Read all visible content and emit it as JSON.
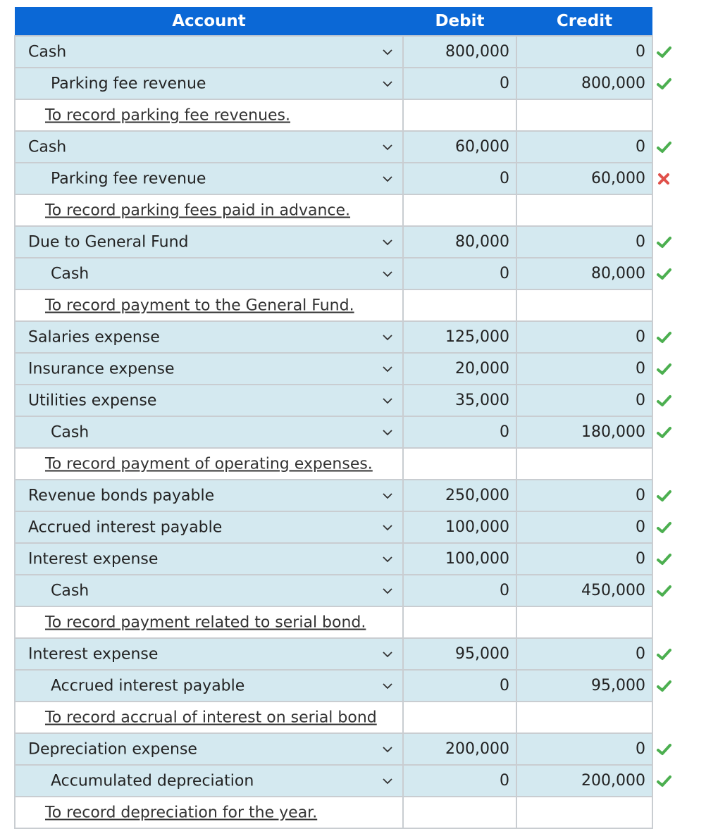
{
  "header": {
    "account": "Account",
    "debit": "Debit",
    "credit": "Credit"
  },
  "colors": {
    "header_bg": "#0b68d6",
    "row_bg": "#d4e9f0",
    "correct": "#4caf50",
    "incorrect": "#e0504a"
  },
  "rows": [
    {
      "type": "entry",
      "indent": false,
      "account": "Cash",
      "debit": "800,000",
      "credit": "0",
      "status": "correct"
    },
    {
      "type": "entry",
      "indent": true,
      "account": "Parking fee revenue",
      "debit": "0",
      "credit": "800,000",
      "status": "correct"
    },
    {
      "type": "memo",
      "text": "To record parking fee revenues."
    },
    {
      "type": "entry",
      "indent": false,
      "account": "Cash",
      "debit": "60,000",
      "credit": "0",
      "status": "correct"
    },
    {
      "type": "entry",
      "indent": true,
      "account": "Parking fee revenue",
      "debit": "0",
      "credit": "60,000",
      "status": "incorrect"
    },
    {
      "type": "memo",
      "text": "To record parking fees paid in advance."
    },
    {
      "type": "entry",
      "indent": false,
      "account": "Due to General Fund",
      "debit": "80,000",
      "credit": "0",
      "status": "correct"
    },
    {
      "type": "entry",
      "indent": true,
      "account": "Cash",
      "debit": "0",
      "credit": "80,000",
      "status": "correct"
    },
    {
      "type": "memo",
      "text": "To record payment to the General Fund."
    },
    {
      "type": "entry",
      "indent": false,
      "account": "Salaries expense",
      "debit": "125,000",
      "credit": "0",
      "status": "correct"
    },
    {
      "type": "entry",
      "indent": false,
      "account": "Insurance expense",
      "debit": "20,000",
      "credit": "0",
      "status": "correct"
    },
    {
      "type": "entry",
      "indent": false,
      "account": "Utilities expense",
      "debit": "35,000",
      "credit": "0",
      "status": "correct"
    },
    {
      "type": "entry",
      "indent": true,
      "account": "Cash",
      "debit": "0",
      "credit": "180,000",
      "status": "correct"
    },
    {
      "type": "memo",
      "text": "To record payment of operating expenses."
    },
    {
      "type": "entry",
      "indent": false,
      "account": "Revenue bonds payable",
      "debit": "250,000",
      "credit": "0",
      "status": "correct"
    },
    {
      "type": "entry",
      "indent": false,
      "account": "Accrued interest payable",
      "debit": "100,000",
      "credit": "0",
      "status": "correct"
    },
    {
      "type": "entry",
      "indent": false,
      "account": "Interest expense",
      "debit": "100,000",
      "credit": "0",
      "status": "correct"
    },
    {
      "type": "entry",
      "indent": true,
      "account": "Cash",
      "debit": "0",
      "credit": "450,000",
      "status": "correct"
    },
    {
      "type": "memo",
      "text": "To record payment related to serial bond."
    },
    {
      "type": "entry",
      "indent": false,
      "account": "Interest expense",
      "debit": "95,000",
      "credit": "0",
      "status": "correct"
    },
    {
      "type": "entry",
      "indent": true,
      "account": "Accrued interest payable",
      "debit": "0",
      "credit": "95,000",
      "status": "correct"
    },
    {
      "type": "memo",
      "text": "To record accrual of interest on serial bond"
    },
    {
      "type": "entry",
      "indent": false,
      "account": "Depreciation expense",
      "debit": "200,000",
      "credit": "0",
      "status": "correct"
    },
    {
      "type": "entry",
      "indent": true,
      "account": "Accumulated depreciation",
      "debit": "0",
      "credit": "200,000",
      "status": "correct"
    },
    {
      "type": "memo",
      "text": "To record depreciation for the year."
    }
  ]
}
